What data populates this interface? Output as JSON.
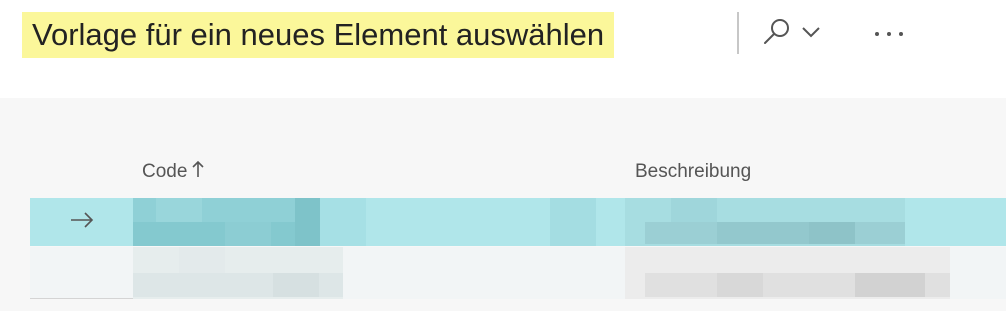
{
  "header": {
    "title": "Vorlage für ein neues Element auswählen",
    "icons": {
      "search": "search-icon",
      "dropdown": "chevron-down-icon",
      "more": "more-horizontal-icon"
    }
  },
  "table": {
    "columns": [
      {
        "label": "Code",
        "sort_icon": "arrow-up-icon"
      },
      {
        "label": "Beschreibung"
      }
    ],
    "rows": [
      {
        "selected": true,
        "indicator_icon": "arrow-right-icon"
      },
      {
        "selected": false
      }
    ]
  },
  "colors": {
    "title_highlight": "#fbf79a",
    "selected_row": "#b0e6ea",
    "panel_background": "#f7f7f7"
  }
}
